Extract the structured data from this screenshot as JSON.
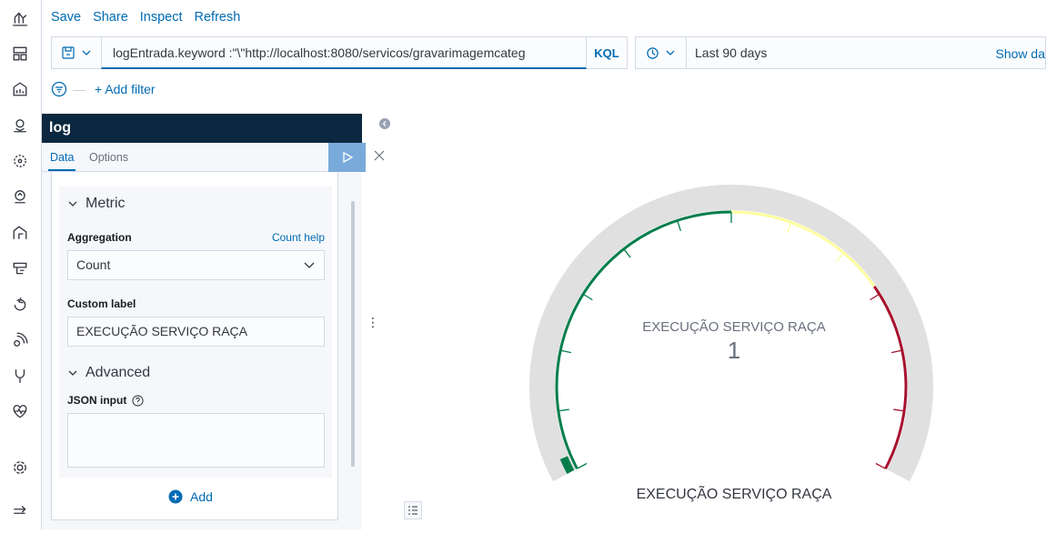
{
  "top_menu": {
    "save": "Save",
    "share": "Share",
    "inspect": "Inspect",
    "refresh": "Refresh"
  },
  "query_bar": {
    "query": "logEntrada.keyword :\"\\\"http://localhost:8080/servicos/gravarimagemcateg",
    "language": "KQL",
    "time_range": "Last 90 days",
    "show_dates": "Show da"
  },
  "filter_bar": {
    "add_filter": "+ Add filter"
  },
  "editor": {
    "index_title": "log",
    "tabs": {
      "data": "Data",
      "options": "Options"
    },
    "metric_section": "Metric",
    "aggregation_label": "Aggregation",
    "count_help": "Count help",
    "aggregation_value": "Count",
    "custom_label_label": "Custom label",
    "custom_label_value": "EXECUÇÃO SERVIÇO RAÇA",
    "advanced_section": "Advanced",
    "json_input_label": "JSON input",
    "add_button": "Add"
  },
  "visualization": {
    "gauge_label": "EXECUÇÃO SERVIÇO RAÇA",
    "gauge_value": "1",
    "title": "EXECUÇÃO SERVIÇO RAÇA",
    "colors": {
      "green": "#017d4b",
      "yellow": "#fdfd9e",
      "red": "#a7122d",
      "track": "#e0e0e0"
    }
  },
  "icons": [
    "visualize-icon",
    "dashboard-icon",
    "canvas-icon",
    "maps-icon",
    "ml-icon",
    "graph-icon",
    "infra-icon",
    "logs-icon",
    "apm-icon",
    "uptime-icon",
    "devtools-icon",
    "monitoring-icon",
    "management-icon",
    "dock-icon"
  ]
}
